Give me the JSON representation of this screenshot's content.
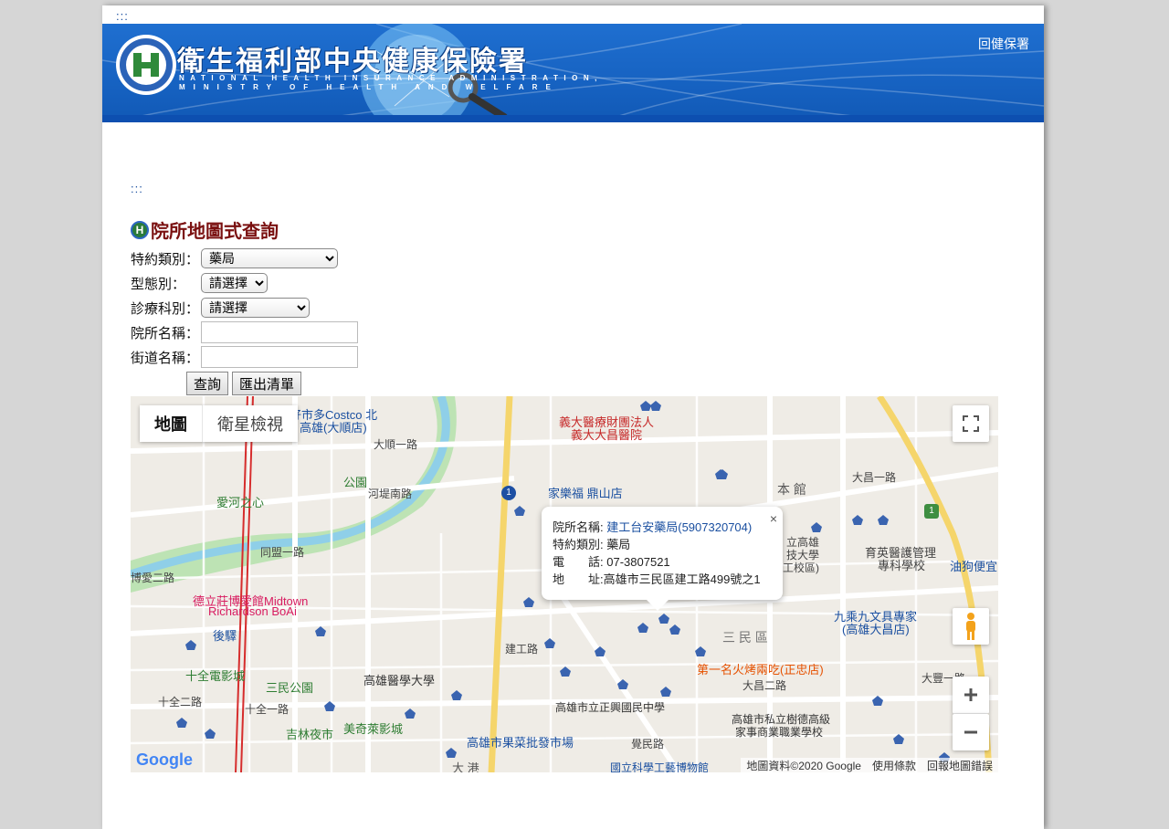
{
  "top_accesskey": ":::",
  "banner": {
    "title_cn": "衛生福利部中央健康保險署",
    "title_en1": "NATIONAL HEALTH INSURANCE ADMINISTRATION,",
    "title_en2": "MINISTRY OF HEALTH AND WELFARE",
    "home_link": "回健保署"
  },
  "content_accesskey": ":::",
  "section": {
    "title": "院所地圖式查詢",
    "logo_letter": "H"
  },
  "form": {
    "category_label": "特約類別：",
    "category_value": "藥局",
    "type_label": "型態別：",
    "type_value": "請選擇",
    "dept_label": "診療科別：",
    "dept_value": "請選擇",
    "name_label": "院所名稱：",
    "name_value": "",
    "street_label": "街道名稱：",
    "street_value": "",
    "search_button": "查詢",
    "export_button": "匯出清單"
  },
  "map": {
    "maptype_map": "地圖",
    "maptype_satellite": "衛星檢視",
    "google": "Google",
    "footer": {
      "data": "地圖資料©2020 Google",
      "terms": "使用條款",
      "report": "回報地圖錯誤"
    },
    "labels": {
      "costco": "好市多Costco 北",
      "costco2": "高雄(大順店)",
      "dashun": "大順一路",
      "hedi": "河堤南路",
      "park": "公園",
      "aihe": "愛河之心",
      "yida": "義大醫療財團法人",
      "yida2": "義大大昌醫院",
      "carrefour": "家樂福 鼎山店",
      "benguan": "本 館",
      "kuas": "立高雄",
      "kuas2": "技大學",
      "kuas3": "工校區)",
      "yuying": "育英醫護管理",
      "yuying2": "專科學校",
      "youguo": "油狗便宜",
      "midtown": "德立莊博愛館Midtown",
      "midtown2": "Richardson BoAi",
      "houyi": "後驛",
      "sanmin_dist": "三 民 區",
      "jiucheng": "九乘九文具專家",
      "jiucheng2": "(高雄大昌店)",
      "shiquan": "十全電影城",
      "sanmin_park": "三民公園",
      "kmu": "高雄醫學大學",
      "bbq": "第一名火烤兩吃(正忠店)",
      "zhengxing": "高雄市立正興國民中學",
      "shude": "高雄市私立樹德高級",
      "shude2": "家事商業職業學校",
      "jilin": "吉林夜市",
      "meiqi": "美奇萊影城",
      "fruit": "高雄市果菜批發市場",
      "dagang": "大 港",
      "museum": "國立科學工藝博物館",
      "zhongdu": "同盟一路",
      "jiangong": "建工路",
      "dachang1": "大昌一路",
      "dachang2": "大昌二路",
      "jueming": "覺民路",
      "shiquan2": "十全一路",
      "shiquan3": "十全二路",
      "bo_ai": "博愛二路",
      "dashun3": "大豐一路"
    },
    "route_badge": "1",
    "route_badge2": "1"
  },
  "popup": {
    "name_label": "院所名稱:",
    "name_value": "建工台安藥局(5907320704)",
    "cat_label": "特約類別:",
    "cat_value": "藥局",
    "tel_label": "電　　話:",
    "tel_value": "07-3807521",
    "addr_label": "地　　址",
    "addr_value": ":高雄市三民區建工路499號之1",
    "close": "×"
  },
  "colors": {
    "banner_blue": "#1560bf",
    "title_red": "#7a1010",
    "pin_blue": "#3a64b0",
    "road_yellow": "#f5d56b",
    "river": "#8fcfe8",
    "park_green": "#bde3b4"
  }
}
